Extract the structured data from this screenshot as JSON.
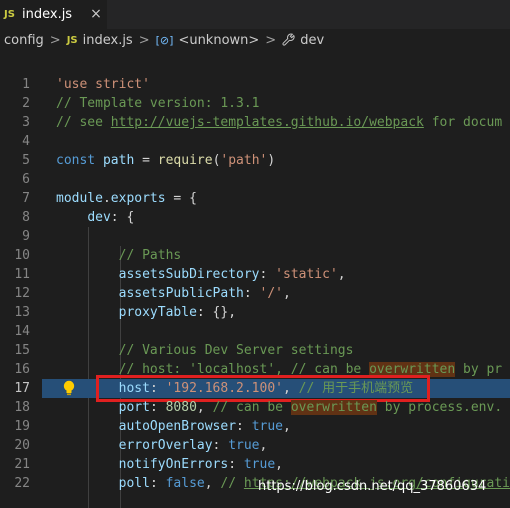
{
  "tab": {
    "badge": "JS",
    "title": "index.js",
    "close": "×"
  },
  "breadcrumb": {
    "items": [
      "config",
      "index.js",
      "<unknown>",
      "dev"
    ],
    "js_badge": "JS",
    "var_icon": "[⊘]",
    "sep": ">"
  },
  "lines": [
    {
      "n": "1",
      "seg": [
        {
          "t": "'use strict'",
          "c": "c-str"
        }
      ]
    },
    {
      "n": "2",
      "seg": [
        {
          "t": "// Template version: 1.3.1",
          "c": "c-com"
        }
      ]
    },
    {
      "n": "3",
      "seg": [
        {
          "t": "// see ",
          "c": "c-com"
        },
        {
          "t": "http://vuejs-templates.github.io/webpack",
          "c": "c-link"
        },
        {
          "t": " for docum",
          "c": "c-com"
        }
      ]
    },
    {
      "n": "4",
      "seg": []
    },
    {
      "n": "5",
      "seg": [
        {
          "t": "const ",
          "c": "c-kw"
        },
        {
          "t": "path",
          "c": "c-var"
        },
        {
          "t": " = ",
          "c": "c-plain"
        },
        {
          "t": "require",
          "c": "c-fn"
        },
        {
          "t": "(",
          "c": "c-plain"
        },
        {
          "t": "'path'",
          "c": "c-str"
        },
        {
          "t": ")",
          "c": "c-plain"
        }
      ]
    },
    {
      "n": "6",
      "seg": []
    },
    {
      "n": "7",
      "seg": [
        {
          "t": "module",
          "c": "c-var"
        },
        {
          "t": ".",
          "c": "c-plain"
        },
        {
          "t": "exports",
          "c": "c-var"
        },
        {
          "t": " = {",
          "c": "c-plain"
        }
      ]
    },
    {
      "n": "8",
      "seg": [
        {
          "t": "    ",
          "c": "c-plain"
        },
        {
          "t": "dev",
          "c": "c-var"
        },
        {
          "t": ": {",
          "c": "c-plain"
        }
      ]
    },
    {
      "n": "9",
      "seg": []
    },
    {
      "n": "10",
      "seg": [
        {
          "t": "        ",
          "c": "c-plain"
        },
        {
          "t": "// Paths",
          "c": "c-com"
        }
      ]
    },
    {
      "n": "11",
      "seg": [
        {
          "t": "        ",
          "c": "c-plain"
        },
        {
          "t": "assetsSubDirectory",
          "c": "c-var"
        },
        {
          "t": ": ",
          "c": "c-plain"
        },
        {
          "t": "'static'",
          "c": "c-str"
        },
        {
          "t": ",",
          "c": "c-plain"
        }
      ]
    },
    {
      "n": "12",
      "seg": [
        {
          "t": "        ",
          "c": "c-plain"
        },
        {
          "t": "assetsPublicPath",
          "c": "c-var"
        },
        {
          "t": ": ",
          "c": "c-plain"
        },
        {
          "t": "'/'",
          "c": "c-str"
        },
        {
          "t": ",",
          "c": "c-plain"
        }
      ]
    },
    {
      "n": "13",
      "seg": [
        {
          "t": "        ",
          "c": "c-plain"
        },
        {
          "t": "proxyTable",
          "c": "c-var"
        },
        {
          "t": ": {},",
          "c": "c-plain"
        }
      ]
    },
    {
      "n": "14",
      "seg": []
    },
    {
      "n": "15",
      "seg": [
        {
          "t": "        ",
          "c": "c-plain"
        },
        {
          "t": "// Various Dev Server settings",
          "c": "c-com"
        }
      ]
    },
    {
      "n": "16",
      "seg": [
        {
          "t": "        ",
          "c": "c-plain"
        },
        {
          "t": "// host: 'localhost', // can be ",
          "c": "c-com"
        },
        {
          "t": "overwritten",
          "c": "c-com c-find"
        },
        {
          "t": " by pr",
          "c": "c-com"
        }
      ]
    },
    {
      "n": "17",
      "seg": [
        {
          "t": "        ",
          "c": "c-plain"
        },
        {
          "t": "host",
          "c": "c-var"
        },
        {
          "t": ": ",
          "c": "c-plain"
        },
        {
          "t": "'192.168.2.100'",
          "c": "c-str"
        },
        {
          "t": ", ",
          "c": "c-plain"
        },
        {
          "t": "// 用于手机端预览",
          "c": "c-com"
        }
      ],
      "active": true
    },
    {
      "n": "18",
      "seg": [
        {
          "t": "        ",
          "c": "c-plain"
        },
        {
          "t": "port",
          "c": "c-var"
        },
        {
          "t": ": ",
          "c": "c-plain"
        },
        {
          "t": "8080",
          "c": "c-num"
        },
        {
          "t": ", ",
          "c": "c-plain"
        },
        {
          "t": "// can be ",
          "c": "c-com"
        },
        {
          "t": "overwritten",
          "c": "c-com c-find"
        },
        {
          "t": " by process.env.",
          "c": "c-com"
        }
      ]
    },
    {
      "n": "19",
      "seg": [
        {
          "t": "        ",
          "c": "c-plain"
        },
        {
          "t": "autoOpenBrowser",
          "c": "c-var"
        },
        {
          "t": ": ",
          "c": "c-plain"
        },
        {
          "t": "true",
          "c": "c-kw"
        },
        {
          "t": ",",
          "c": "c-plain"
        }
      ]
    },
    {
      "n": "20",
      "seg": [
        {
          "t": "        ",
          "c": "c-plain"
        },
        {
          "t": "errorOverlay",
          "c": "c-var"
        },
        {
          "t": ": ",
          "c": "c-plain"
        },
        {
          "t": "true",
          "c": "c-kw"
        },
        {
          "t": ",",
          "c": "c-plain"
        }
      ]
    },
    {
      "n": "21",
      "seg": [
        {
          "t": "        ",
          "c": "c-plain"
        },
        {
          "t": "notifyOnErrors",
          "c": "c-var"
        },
        {
          "t": ": ",
          "c": "c-plain"
        },
        {
          "t": "true",
          "c": "c-kw"
        },
        {
          "t": ",",
          "c": "c-plain"
        }
      ]
    },
    {
      "n": "22",
      "seg": [
        {
          "t": "        ",
          "c": "c-plain"
        },
        {
          "t": "poll",
          "c": "c-var"
        },
        {
          "t": ": ",
          "c": "c-plain"
        },
        {
          "t": "false",
          "c": "c-kw"
        },
        {
          "t": ", ",
          "c": "c-plain"
        },
        {
          "t": "// ",
          "c": "c-com"
        },
        {
          "t": "https://webpack.js.org/configuration",
          "c": "c-link"
        }
      ]
    }
  ],
  "watermark": "https://blog.csdn.net/qq_37860634",
  "colors": {
    "background": "#1e1e1e",
    "selection": "#264f78",
    "highlight_box": "#e02020",
    "find_match": "#613214"
  },
  "icons": {
    "tab_icon": "js-file-icon",
    "bulb": "lightbulb-icon",
    "dev_icon": "wrench-icon"
  }
}
